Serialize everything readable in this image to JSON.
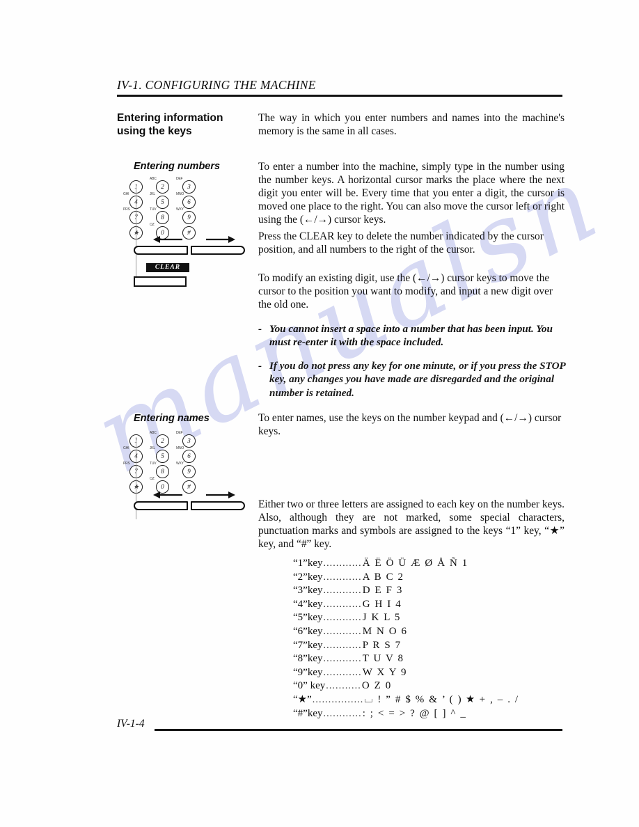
{
  "page": {
    "running_head": "IV-1. CONFIGURING THE MACHINE",
    "folio": "IV-1-4",
    "watermark_text": "manualsn"
  },
  "section": {
    "title": "Entering information\nusing the keys",
    "intro": "The way in which you enter numbers and names into the machine's memory is the same in all cases."
  },
  "entering_numbers": {
    "heading": "Entering numbers",
    "paragraphs": [
      "To enter a number into the machine, simply type in the number using the number keys. A horizontal cursor marks the place where the next digit you enter will be. Every time that you enter a digit, the cursor is moved one place to the right. You can also move the cursor left or right using the (←/→) cursor keys.",
      "Press the CLEAR key to delete the number indicated by the cursor position, and all numbers to the right of the cursor.",
      "To modify an existing digit, use the (←/→) cursor keys to move the cursor to the position you want to modify, and input a new digit over the old one."
    ],
    "notes": [
      {
        "dash": "-",
        "text": "You cannot insert a space into a number that has been input. You must re-enter it with the space included."
      },
      {
        "dash": "-",
        "text": "If you do not press any key for one minute, or if you press the STOP key, any changes you have made are disregarded and the original number is retained."
      }
    ]
  },
  "entering_names": {
    "heading": "Entering names",
    "paragraphs": [
      "To enter names, use the keys on the number keypad and (←/→) cursor keys.",
      "Either two or three letters are assigned to each key on the number keys. Also, although they are not marked, some special characters, punctuation marks and symbols are assigned to the keys “1” key, “★” key, and “#” key."
    ],
    "key_assignments": [
      {
        "key": "“1”key",
        "leader": "............",
        "values": "Ä Ë Ö Ü Æ Ø Å Ñ 1"
      },
      {
        "key": "“2”key",
        "leader": "............",
        "values": "A B C 2"
      },
      {
        "key": "“3”key",
        "leader": "............",
        "values": "D E F 3"
      },
      {
        "key": "“4”key",
        "leader": "............",
        "values": "G H I 4"
      },
      {
        "key": "“5”key",
        "leader": "............",
        "values": "J K L 5"
      },
      {
        "key": "“6”key",
        "leader": "............",
        "values": "M N O 6"
      },
      {
        "key": "“7”key",
        "leader": "............",
        "values": "P R S 7"
      },
      {
        "key": "“8”key",
        "leader": "............",
        "values": "T U V 8"
      },
      {
        "key": "“9”key",
        "leader": "............",
        "values": "W X Y 9"
      },
      {
        "key": "“0” key",
        "leader": "...........",
        "values": "O Z 0"
      },
      {
        "key": "“★”",
        "leader": "................",
        "values": "⌴ ! ” # $ % & ’ ( ) ★ + , – . /"
      },
      {
        "key": "“#”key",
        "leader": "............",
        "values": ": ; < = > ? @ [ ] ^ _"
      }
    ]
  },
  "keypad_diagram": {
    "keys": [
      {
        "digit": "1",
        "label": ""
      },
      {
        "digit": "2",
        "label": "ABC"
      },
      {
        "digit": "3",
        "label": "DEF"
      },
      {
        "digit": "4",
        "label": "GHI"
      },
      {
        "digit": "5",
        "label": "JKL"
      },
      {
        "digit": "6",
        "label": "MNO"
      },
      {
        "digit": "7",
        "label": "PRS"
      },
      {
        "digit": "8",
        "label": "TUV"
      },
      {
        "digit": "9",
        "label": "WXY"
      },
      {
        "digit": "★",
        "label": ""
      },
      {
        "digit": "0",
        "label": "OZ"
      },
      {
        "digit": "#",
        "label": ""
      }
    ],
    "left_arrow": "←",
    "right_arrow": "→",
    "clear_label": "CLEAR"
  }
}
